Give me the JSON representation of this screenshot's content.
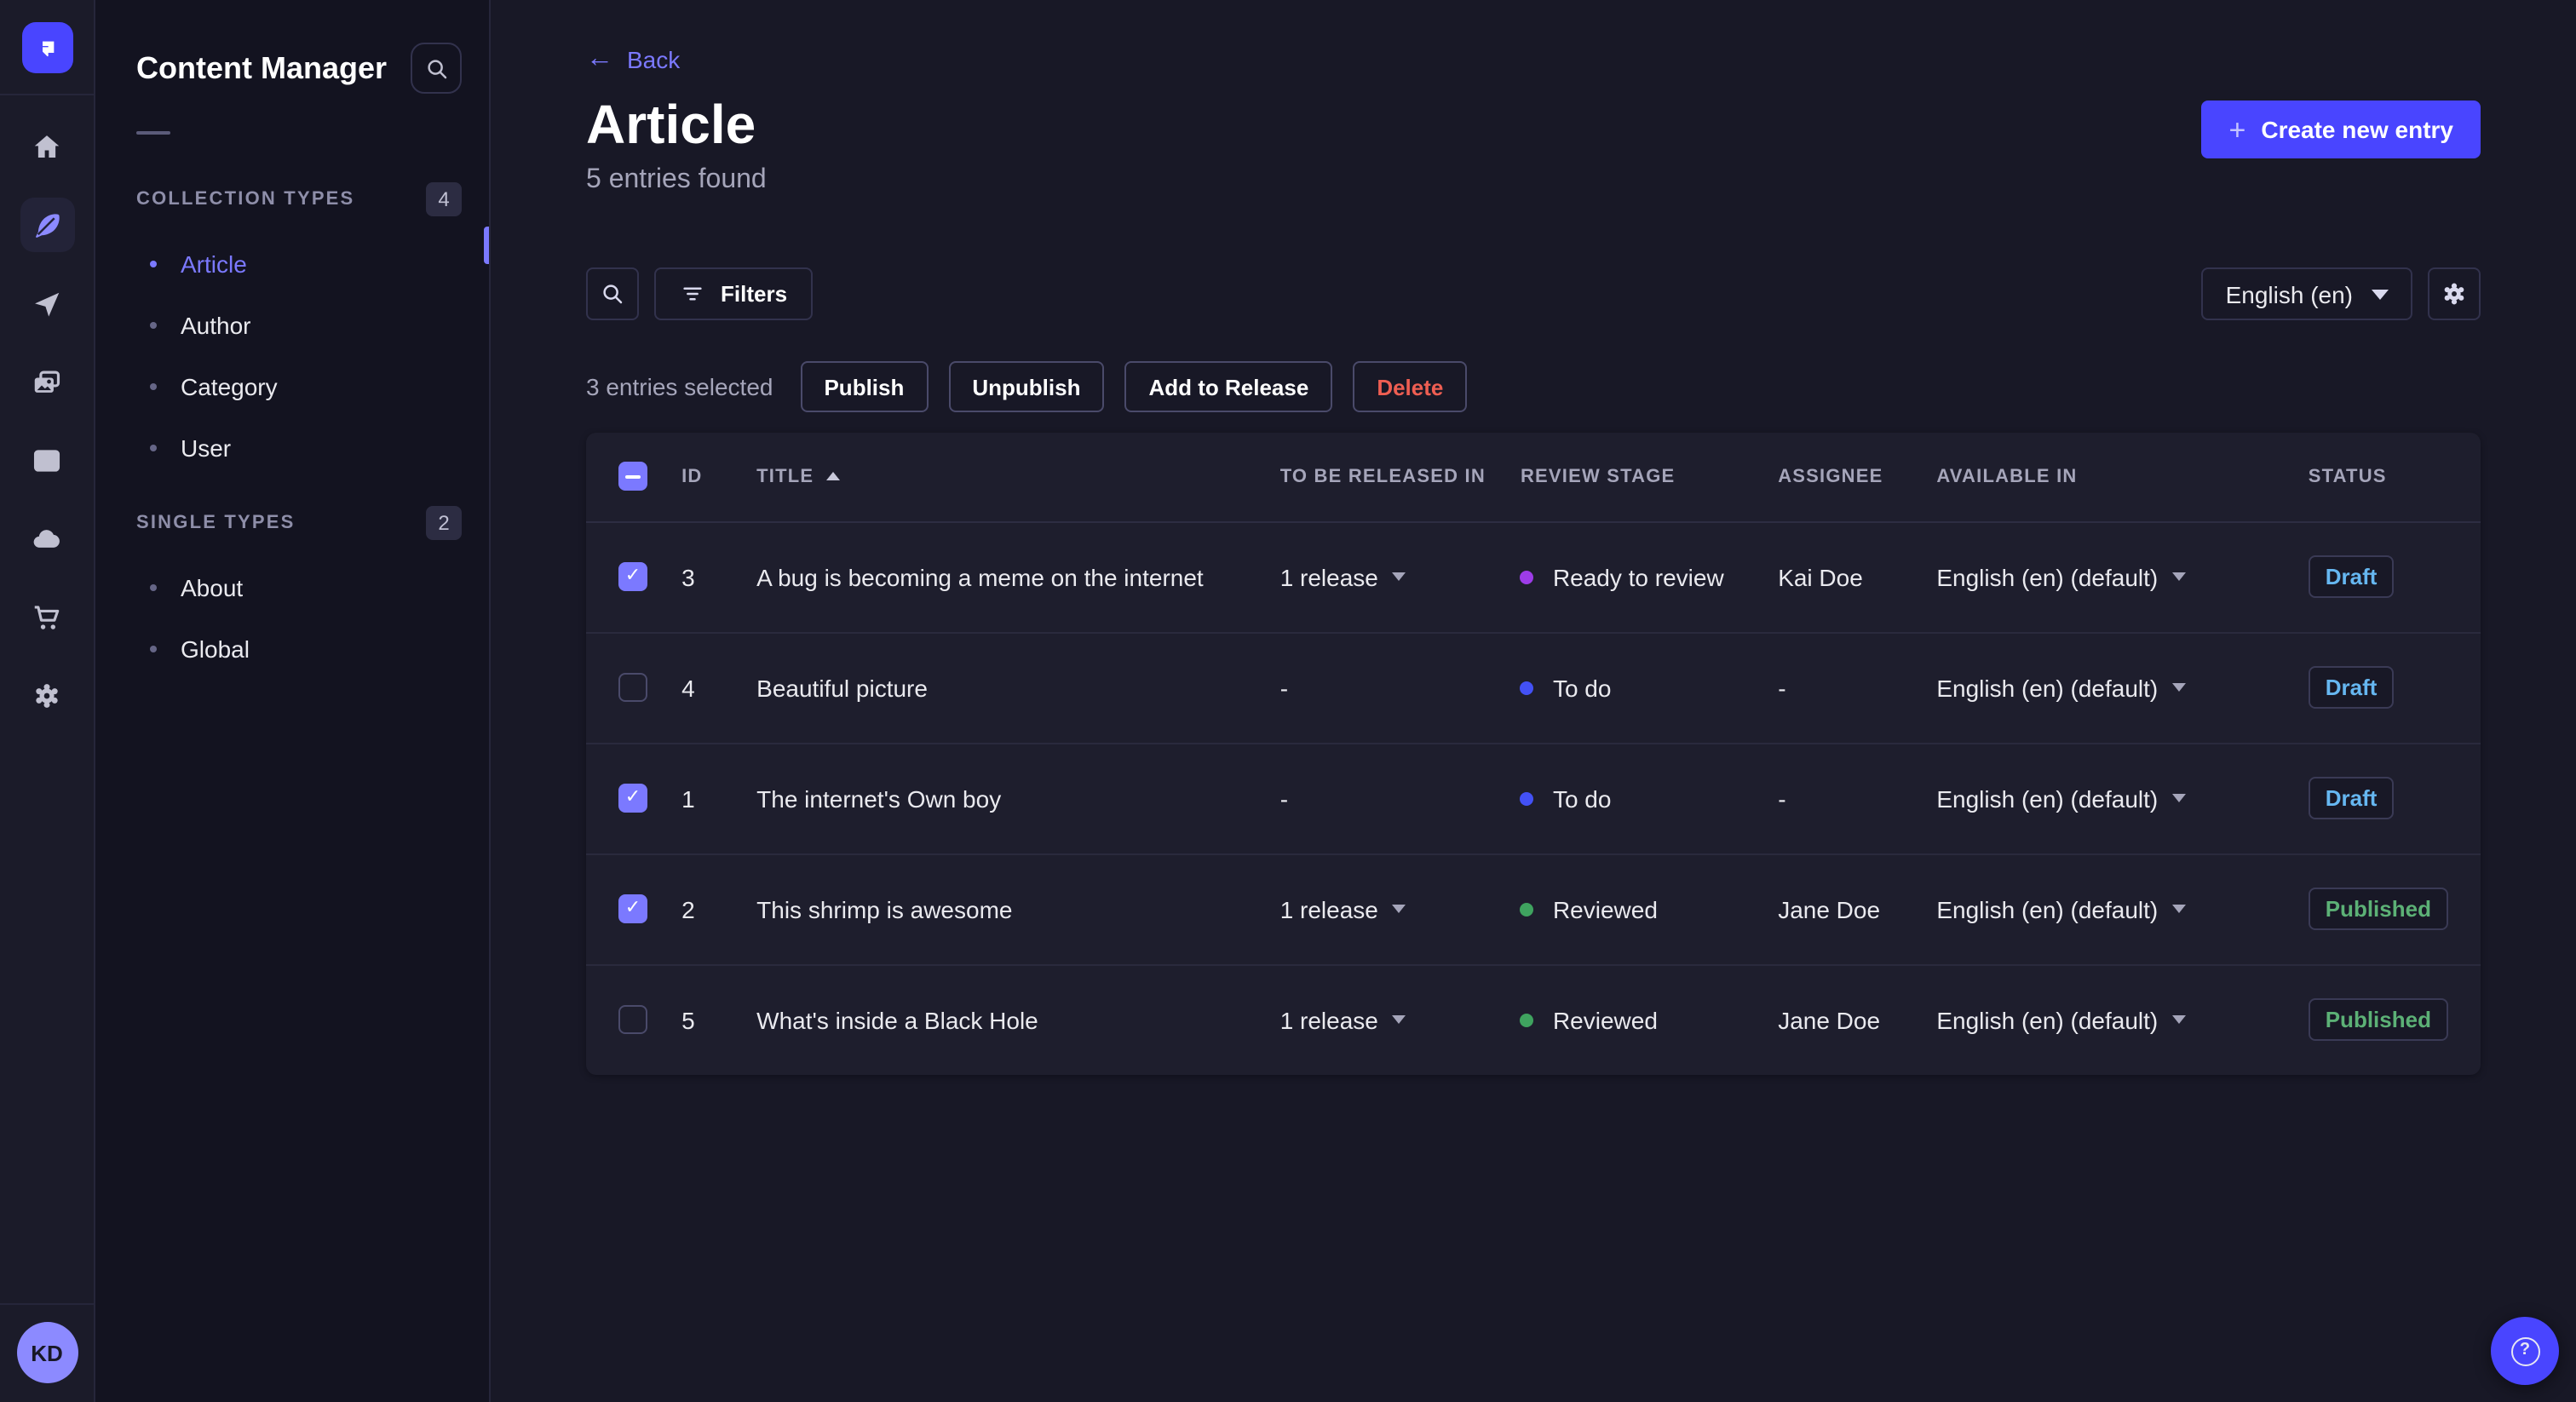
{
  "colors": {
    "primary": "#4945ff",
    "primary_light": "#7b79ff",
    "draft": "#66b7f1",
    "published": "#5cb176",
    "danger": "#ee5e52"
  },
  "rail": {
    "icons": [
      "home",
      "content-manager",
      "releases",
      "media-library",
      "content-type-builder",
      "deploy",
      "marketplace",
      "settings"
    ],
    "active_icon": "content-manager",
    "avatar_initials": "KD"
  },
  "nav": {
    "title": "Content Manager",
    "sections": [
      {
        "label": "COLLECTION TYPES",
        "count": "4",
        "items": [
          {
            "label": "Article",
            "active": true
          },
          {
            "label": "Author",
            "active": false
          },
          {
            "label": "Category",
            "active": false
          },
          {
            "label": "User",
            "active": false
          }
        ]
      },
      {
        "label": "SINGLE TYPES",
        "count": "2",
        "items": [
          {
            "label": "About",
            "active": false
          },
          {
            "label": "Global",
            "active": false
          }
        ]
      }
    ]
  },
  "header": {
    "back_label": "Back",
    "title": "Article",
    "subtitle": "5 entries found",
    "create_button": "Create new entry"
  },
  "toolbar": {
    "filters_label": "Filters",
    "locale": "English (en)"
  },
  "selection": {
    "text": "3 entries selected",
    "actions": [
      "Publish",
      "Unpublish",
      "Add to Release",
      "Delete"
    ]
  },
  "table": {
    "columns": [
      "ID",
      "TITLE",
      "TO BE RELEASED IN",
      "REVIEW STAGE",
      "ASSIGNEE",
      "AVAILABLE IN",
      "STATUS"
    ],
    "sorted_column": "TITLE",
    "sort_direction": "asc",
    "rows": [
      {
        "checked": true,
        "id": "3",
        "title": "A bug is becoming a meme on the internet",
        "release": "1 release",
        "stage": "Ready to review",
        "stage_color": "#9d3ce8",
        "assignee": "Kai Doe",
        "locale": "English (en) (default)",
        "status": "Draft"
      },
      {
        "checked": false,
        "id": "4",
        "title": "Beautiful picture",
        "release": "-",
        "stage": "To do",
        "stage_color": "#4351f5",
        "assignee": "-",
        "locale": "English (en) (default)",
        "status": "Draft"
      },
      {
        "checked": true,
        "id": "1",
        "title": "The internet's Own boy",
        "release": "-",
        "stage": "To do",
        "stage_color": "#4351f5",
        "assignee": "-",
        "locale": "English (en) (default)",
        "status": "Draft"
      },
      {
        "checked": true,
        "id": "2",
        "title": "This shrimp is awesome",
        "release": "1 release",
        "stage": "Reviewed",
        "stage_color": "#3fa35f",
        "assignee": "Jane Doe",
        "locale": "English (en) (default)",
        "status": "Published"
      },
      {
        "checked": false,
        "id": "5",
        "title": "What's inside a Black Hole",
        "release": "1 release",
        "stage": "Reviewed",
        "stage_color": "#3fa35f",
        "assignee": "Jane Doe",
        "locale": "English (en) (default)",
        "status": "Published"
      }
    ]
  },
  "fab": {
    "help_glyph": "?"
  }
}
